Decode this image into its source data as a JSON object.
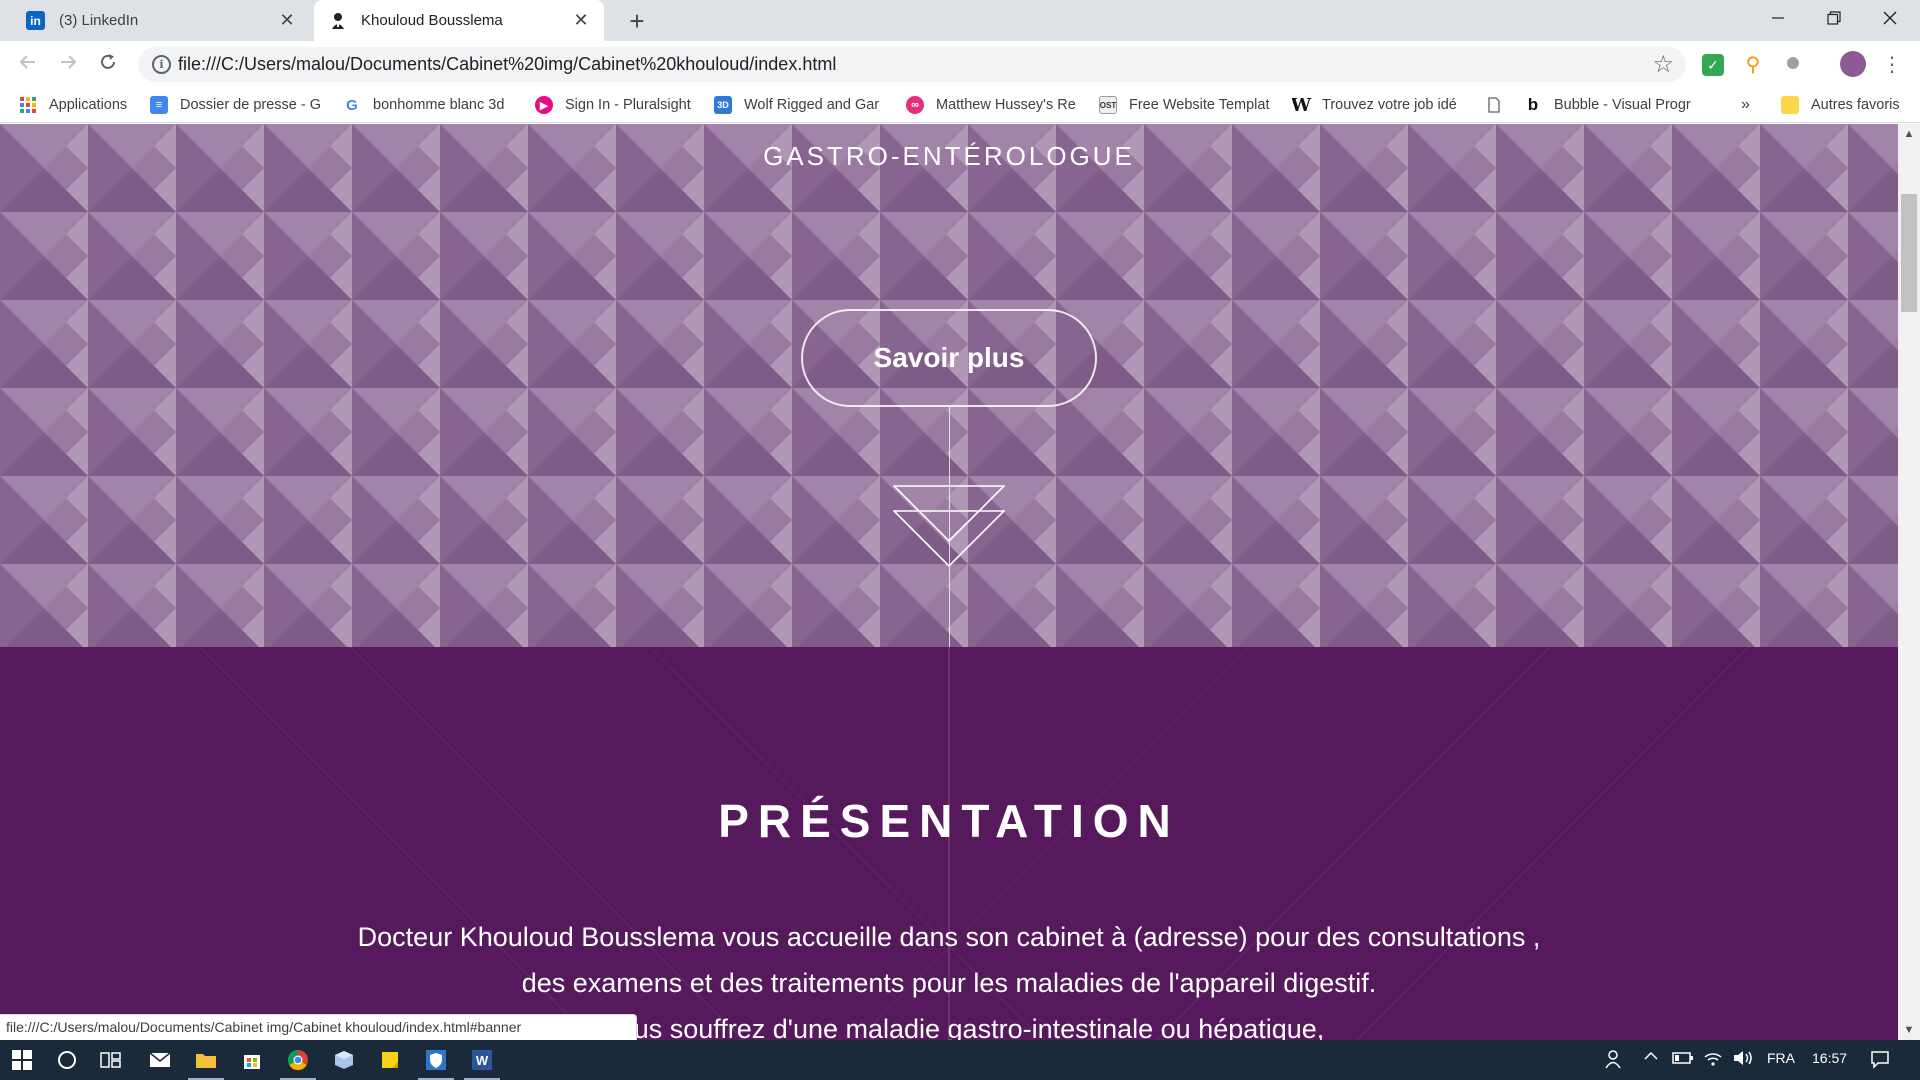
{
  "browser": {
    "tabs": [
      {
        "title": "(3) LinkedIn",
        "icon": "linkedin-icon",
        "active": false
      },
      {
        "title": "Khouloud Bousslema",
        "icon": "doctor-icon",
        "active": true
      }
    ],
    "url": "file:///C:/Users/malou/Documents/Cabinet%20img/Cabinet%20khouloud/index.html",
    "info_glyph": "i",
    "close_glyph": "✕",
    "new_tab_glyph": "+",
    "bookmarks": [
      {
        "label": "Applications",
        "icon": "apps-grid-icon"
      },
      {
        "label": "Dossier de presse - G",
        "icon": "google-docs-icon"
      },
      {
        "label": "bonhomme blanc 3d",
        "icon": "google-icon"
      },
      {
        "label": "Sign In - Pluralsight",
        "icon": "pluralsight-icon"
      },
      {
        "label": "Wolf Rigged and Gar",
        "icon": "3d-icon"
      },
      {
        "label": "Matthew Hussey's Re",
        "icon": "matthew-hussey-icon"
      },
      {
        "label": "Free Website Templat",
        "icon": "ost-icon"
      },
      {
        "label": "Trouvez votre job idé",
        "icon": "w-icon"
      },
      {
        "label": "",
        "icon": "page-icon"
      },
      {
        "label": "Bubble - Visual Progr",
        "icon": "bubble-icon"
      }
    ],
    "bookmarks_overflow": "»",
    "other_bookmarks": "Autres favoris",
    "status_url": "file:///C:/Users/malou/Documents/Cabinet img/Cabinet khouloud/index.html#banner",
    "colors": {
      "tabstrip": "#dee1e6",
      "omnibox": "#f1f3f4"
    }
  },
  "page": {
    "banner": {
      "subtitle": "GASTRO-ENTÉROLOGUE",
      "button_label": "Savoir plus",
      "background": "#97729e"
    },
    "presentation": {
      "title": "PRÉSENTATION",
      "lines": [
        "Docteur Khouloud Bousslema vous accueille dans son cabinet à (adresse) pour des consultations ,",
        "des examens et des traitements pour les maladies de l'appareil digestif.",
        "Si vous souffrez d'une maladie gastro-intestinale ou hépatique,"
      ],
      "background": "#561a5c"
    }
  },
  "taskbar": {
    "language": "FRA",
    "time": "16:57",
    "apps": [
      "start-icon",
      "cortana-icon",
      "task-view-icon",
      "mail-icon",
      "file-explorer-icon",
      "store-icon",
      "chrome-icon",
      "box-app-icon",
      "sticky-notes-icon",
      "security-icon",
      "word-icon"
    ]
  }
}
